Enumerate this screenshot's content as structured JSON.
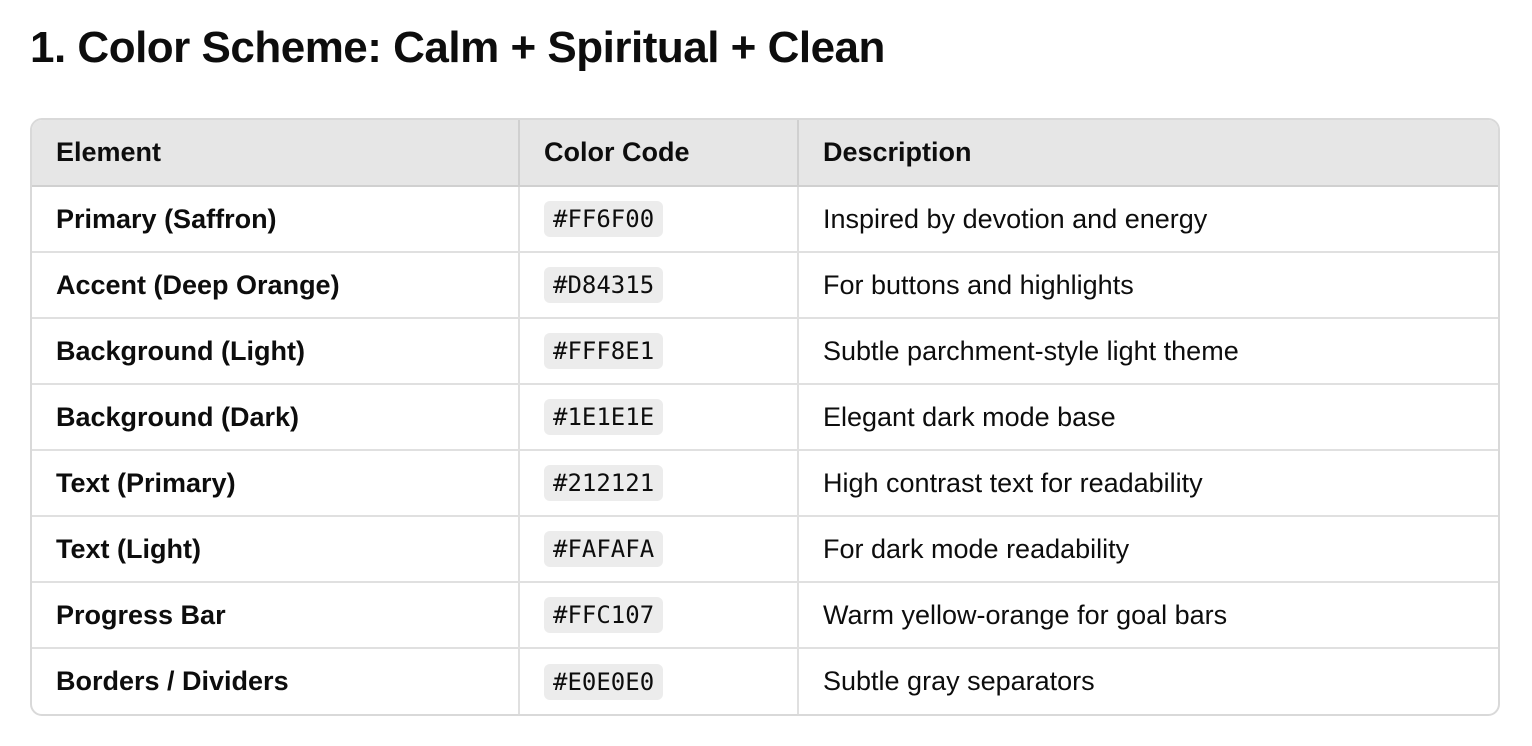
{
  "page": {
    "title": "1. Color Scheme: Calm + Spiritual + Clean"
  },
  "table": {
    "headers": [
      "Element",
      "Color Code",
      "Description"
    ],
    "rows": [
      {
        "element": "Primary (Saffron)",
        "code": "#FF6F00",
        "description": "Inspired by devotion and energy"
      },
      {
        "element": "Accent (Deep Orange)",
        "code": "#D84315",
        "description": "For buttons and highlights"
      },
      {
        "element": "Background (Light)",
        "code": "#FFF8E1",
        "description": "Subtle parchment-style light theme"
      },
      {
        "element": "Background (Dark)",
        "code": "#1E1E1E",
        "description": "Elegant dark mode base"
      },
      {
        "element": "Text (Primary)",
        "code": "#212121",
        "description": "High contrast text for readability"
      },
      {
        "element": "Text (Light)",
        "code": "#FAFAFA",
        "description": "For dark mode readability"
      },
      {
        "element": "Progress Bar",
        "code": "#FFC107",
        "description": "Warm yellow-orange for goal bars"
      },
      {
        "element": "Borders / Dividers",
        "code": "#E0E0E0",
        "description": "Subtle gray separators"
      }
    ]
  }
}
